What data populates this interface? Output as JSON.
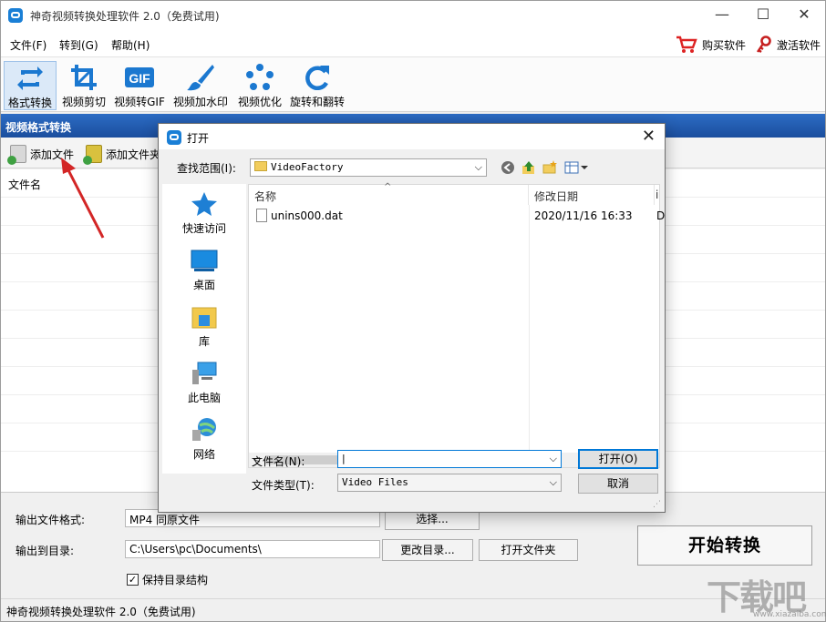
{
  "window": {
    "title": "神奇视频转换处理软件 2.0（免费试用)",
    "minimize": "—",
    "maximize": "☐",
    "close": "✕"
  },
  "menu": {
    "file": "文件(F)",
    "goto": "转到(G)",
    "help": "帮助(H)",
    "buy": "购买软件",
    "activate": "激活软件"
  },
  "toolbar": {
    "items": [
      {
        "label": "格式转换",
        "icon": "convert-icon"
      },
      {
        "label": "视频剪切",
        "icon": "crop-icon"
      },
      {
        "label": "视频转GIF",
        "icon": "gif-icon"
      },
      {
        "label": "视频加水印",
        "icon": "brush-icon"
      },
      {
        "label": "视频优化",
        "icon": "optimize-icon"
      },
      {
        "label": "旋转和翻转",
        "icon": "rotate-icon"
      }
    ],
    "gif_text": "GIF"
  },
  "section": {
    "title": "视频格式转换"
  },
  "subtoolbar": {
    "add_file": "添加文件",
    "add_folder": "添加文件夹"
  },
  "list": {
    "column_filename": "文件名"
  },
  "bottom": {
    "output_format_label": "输出文件格式:",
    "output_format_value": "MP4 同原文件",
    "select_button": "选择...",
    "output_dir_label": "输出到目录:",
    "output_dir_value": "C:\\Users\\pc\\Documents\\",
    "change_dir_button": "更改目录...",
    "open_folder_button": "打开文件夹",
    "start_button": "开始转换",
    "keep_structure": "保持目录结构",
    "keep_structure_checked": "✓"
  },
  "status": {
    "text": "神奇视频转换处理软件 2.0（免费试用)"
  },
  "dialog": {
    "title": "打开",
    "look_in_label": "查找范围(I):",
    "look_in_value": "VideoFactory",
    "places": [
      {
        "label": "快速访问",
        "icon": "star-icon"
      },
      {
        "label": "桌面",
        "icon": "desktop-icon"
      },
      {
        "label": "库",
        "icon": "library-icon"
      },
      {
        "label": "此电脑",
        "icon": "computer-icon"
      },
      {
        "label": "网络",
        "icon": "network-icon"
      }
    ],
    "columns": {
      "name": "名称",
      "date": "修改日期",
      "type": "i"
    },
    "files": [
      {
        "name": "unins000.dat",
        "date": "2020/11/16 16:33",
        "type": "D"
      }
    ],
    "filename_label": "文件名(N):",
    "filename_value": "",
    "filetype_label": "文件类型(T):",
    "filetype_value": "Video Files",
    "open_button": "打开(O)",
    "cancel_button": "取消"
  },
  "watermark": {
    "text": "下载吧",
    "sub": "www.xiazaiba.com"
  },
  "colors": {
    "accent": "#1b4e9e",
    "arrow": "#d32626"
  }
}
